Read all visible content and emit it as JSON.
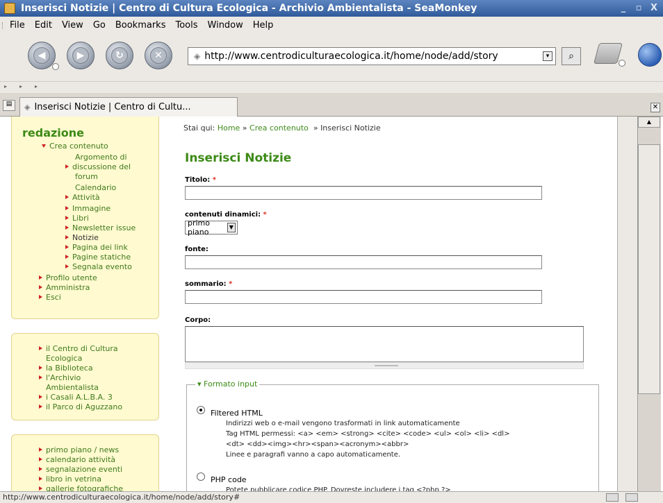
{
  "window": {
    "title": "Inserisci Notizie | Centro di Cultura Ecologica - Archivio Ambientalista - SeaMonkey",
    "controls": [
      "_",
      "▫",
      "X"
    ]
  },
  "menubar": [
    "File",
    "Edit",
    "View",
    "Go",
    "Bookmarks",
    "Tools",
    "Window",
    "Help"
  ],
  "toolbar": {
    "url": "http://www.centrodiculturaecologica.it/home/node/add/story"
  },
  "tab": {
    "label": "Inserisci Notizie | Centro di Cultu..."
  },
  "sidebar": {
    "title": "redazione",
    "crea_contenuto": "Crea contenuto",
    "crea_items": [
      "Argomento di",
      "discussione del",
      "forum",
      "Calendario",
      "Attività",
      "Immagine",
      "Libri",
      "Newsletter issue",
      "Notizie",
      "Pagina dei link",
      "Pagine statiche",
      "Segnala evento"
    ],
    "other_items": [
      "Profilo utente",
      "Amministra",
      "Esci"
    ],
    "block2_items": [
      "il Centro di Cultura",
      "Ecologica",
      "la Biblioteca",
      "l'Archivio",
      "Ambientalista",
      "i Casali A.L.B.A. 3",
      "il Parco di Aguzzano"
    ],
    "block3_items": [
      "primo piano / news",
      "calendario attività",
      "segnalazione eventi",
      "libro in vetrina",
      "gallerie fotografiche"
    ]
  },
  "main": {
    "breadcrumb_prefix": "Stai qui:",
    "breadcrumb_home": "Home",
    "breadcrumb_sep1": "»",
    "breadcrumb_crea": "Crea contenuto",
    "breadcrumb_sep2": "»",
    "breadcrumb_current": "Inserisci Notizie",
    "title": "Inserisci Notizie",
    "titolo_label": "Titolo:",
    "dinamici_label": "contenuti dinamici:",
    "dinamici_value": "primo piano",
    "fonte_label": "fonte:",
    "sommario_label": "sommario:",
    "corpo_label": "Corpo:",
    "required_mark": "*",
    "formato_legend": "Formato input",
    "filtered_title": "Filtered HTML",
    "filtered_desc1": "Indirizzi web o e-mail vengono trasformati in link automaticamente",
    "filtered_desc2": "Tag HTML permessi: <a> <em> <strong> <cite> <code> <ul> <ol> <li> <dl>",
    "filtered_desc3": "<dt> <dd><img><hr><span><acronym><abbr>",
    "filtered_desc4": "Linee e paragrafi vanno a capo automaticamente.",
    "php_title": "PHP code",
    "php_desc": "Potete pubblicare codice PHP. Dovreste includere i tag <?php ?>."
  },
  "statusbar": {
    "text": "http://www.centrodiculturaecologica.it/home/node/add/story#"
  }
}
